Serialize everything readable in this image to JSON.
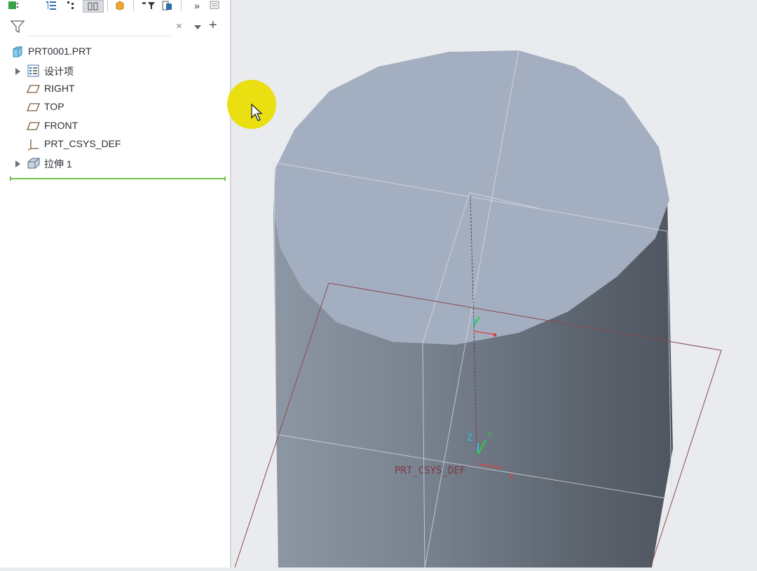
{
  "model_tree": {
    "root": {
      "label": "PRT0001.PRT",
      "icon": "part-icon"
    },
    "items": [
      {
        "label": "设计项",
        "icon": "design-items-icon",
        "expandable": true
      },
      {
        "label": "RIGHT",
        "icon": "datum-plane-icon",
        "expandable": false
      },
      {
        "label": "TOP",
        "icon": "datum-plane-icon",
        "expandable": false
      },
      {
        "label": "FRONT",
        "icon": "datum-plane-icon",
        "expandable": false
      },
      {
        "label": "PRT_CSYS_DEF",
        "icon": "csys-icon",
        "expandable": false
      },
      {
        "label": "拉伸 1",
        "icon": "extrude-icon",
        "expandable": true
      }
    ]
  },
  "filter": {
    "value": "",
    "placeholder": ""
  },
  "viewport": {
    "csys_label": "PRT_CSYS_DEF",
    "axis_z": "Z",
    "axis_y": "Y",
    "axis_x": "X"
  },
  "colors": {
    "cylinder_top": "#a3afc0",
    "cylinder_side_light": "#8994a2",
    "cylinder_side_dark": "#545c66",
    "datum_plane": "#8a4a52",
    "insert_line": "#73c04a",
    "cursor_highlight": "#e8de00"
  }
}
